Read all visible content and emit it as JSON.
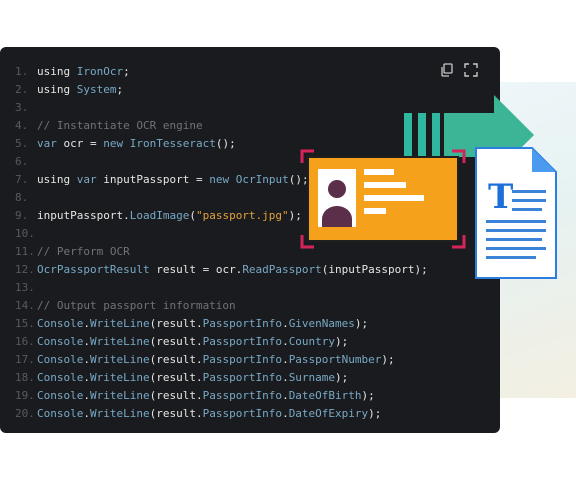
{
  "code": {
    "lines": [
      {
        "n": "1.",
        "tokens": [
          {
            "t": "using ",
            "c": "kw"
          },
          {
            "t": "IronOcr",
            "c": "ty"
          },
          {
            "t": ";",
            "c": "pl"
          }
        ]
      },
      {
        "n": "2.",
        "tokens": [
          {
            "t": "using ",
            "c": "kw"
          },
          {
            "t": "System",
            "c": "ty"
          },
          {
            "t": ";",
            "c": "pl"
          }
        ]
      },
      {
        "n": "3.",
        "tokens": []
      },
      {
        "n": "4.",
        "tokens": [
          {
            "t": "// Instantiate OCR engine",
            "c": "cm"
          }
        ]
      },
      {
        "n": "5.",
        "tokens": [
          {
            "t": "var",
            "c": "ty"
          },
          {
            "t": " ocr = ",
            "c": "pl"
          },
          {
            "t": "new",
            "c": "ty"
          },
          {
            "t": " ",
            "c": "pl"
          },
          {
            "t": "IronTesseract",
            "c": "ty"
          },
          {
            "t": "();",
            "c": "pl"
          }
        ]
      },
      {
        "n": "6.",
        "tokens": []
      },
      {
        "n": "7.",
        "tokens": [
          {
            "t": "using ",
            "c": "kw"
          },
          {
            "t": "var",
            "c": "ty"
          },
          {
            "t": " inputPassport = ",
            "c": "pl"
          },
          {
            "t": "new",
            "c": "ty"
          },
          {
            "t": " ",
            "c": "pl"
          },
          {
            "t": "OcrInput",
            "c": "ty"
          },
          {
            "t": "();",
            "c": "pl"
          }
        ]
      },
      {
        "n": "8.",
        "tokens": []
      },
      {
        "n": "9.",
        "tokens": [
          {
            "t": "inputPassport.",
            "c": "pl"
          },
          {
            "t": "LoadImage",
            "c": "ty"
          },
          {
            "t": "(",
            "c": "pl"
          },
          {
            "t": "\"passport.jpg\"",
            "c": "st"
          },
          {
            "t": ");",
            "c": "pl"
          }
        ]
      },
      {
        "n": "10.",
        "tokens": []
      },
      {
        "n": "11.",
        "tokens": [
          {
            "t": "// Perform OCR",
            "c": "cm"
          }
        ]
      },
      {
        "n": "12.",
        "tokens": [
          {
            "t": "OcrPassportResult",
            "c": "ty"
          },
          {
            "t": " result = ocr.",
            "c": "pl"
          },
          {
            "t": "ReadPassport",
            "c": "ty"
          },
          {
            "t": "(inputPassport);",
            "c": "pl"
          }
        ]
      },
      {
        "n": "13.",
        "tokens": []
      },
      {
        "n": "14.",
        "tokens": [
          {
            "t": "// Output passport information",
            "c": "cm"
          }
        ]
      },
      {
        "n": "15.",
        "tokens": [
          {
            "t": "Console",
            "c": "ty"
          },
          {
            "t": ".",
            "c": "pl"
          },
          {
            "t": "WriteLine",
            "c": "ty"
          },
          {
            "t": "(result.",
            "c": "pl"
          },
          {
            "t": "PassportInfo",
            "c": "ty"
          },
          {
            "t": ".",
            "c": "pl"
          },
          {
            "t": "GivenNames",
            "c": "ty"
          },
          {
            "t": ");",
            "c": "pl"
          }
        ]
      },
      {
        "n": "16.",
        "tokens": [
          {
            "t": "Console",
            "c": "ty"
          },
          {
            "t": ".",
            "c": "pl"
          },
          {
            "t": "WriteLine",
            "c": "ty"
          },
          {
            "t": "(result.",
            "c": "pl"
          },
          {
            "t": "PassportInfo",
            "c": "ty"
          },
          {
            "t": ".",
            "c": "pl"
          },
          {
            "t": "Country",
            "c": "ty"
          },
          {
            "t": ");",
            "c": "pl"
          }
        ]
      },
      {
        "n": "17.",
        "tokens": [
          {
            "t": "Console",
            "c": "ty"
          },
          {
            "t": ".",
            "c": "pl"
          },
          {
            "t": "WriteLine",
            "c": "ty"
          },
          {
            "t": "(result.",
            "c": "pl"
          },
          {
            "t": "PassportInfo",
            "c": "ty"
          },
          {
            "t": ".",
            "c": "pl"
          },
          {
            "t": "PassportNumber",
            "c": "ty"
          },
          {
            "t": ");",
            "c": "pl"
          }
        ]
      },
      {
        "n": "18.",
        "tokens": [
          {
            "t": "Console",
            "c": "ty"
          },
          {
            "t": ".",
            "c": "pl"
          },
          {
            "t": "WriteLine",
            "c": "ty"
          },
          {
            "t": "(result.",
            "c": "pl"
          },
          {
            "t": "PassportInfo",
            "c": "ty"
          },
          {
            "t": ".",
            "c": "pl"
          },
          {
            "t": "Surname",
            "c": "ty"
          },
          {
            "t": ");",
            "c": "pl"
          }
        ]
      },
      {
        "n": "19.",
        "tokens": [
          {
            "t": "Console",
            "c": "ty"
          },
          {
            "t": ".",
            "c": "pl"
          },
          {
            "t": "WriteLine",
            "c": "ty"
          },
          {
            "t": "(result.",
            "c": "pl"
          },
          {
            "t": "PassportInfo",
            "c": "ty"
          },
          {
            "t": ".",
            "c": "pl"
          },
          {
            "t": "DateOfBirth",
            "c": "ty"
          },
          {
            "t": ");",
            "c": "pl"
          }
        ]
      },
      {
        "n": "20.",
        "tokens": [
          {
            "t": "Console",
            "c": "ty"
          },
          {
            "t": ".",
            "c": "pl"
          },
          {
            "t": "WriteLine",
            "c": "ty"
          },
          {
            "t": "(result.",
            "c": "pl"
          },
          {
            "t": "PassportInfo",
            "c": "ty"
          },
          {
            "t": ".",
            "c": "pl"
          },
          {
            "t": "DateOfExpiry",
            "c": "ty"
          },
          {
            "t": ");",
            "c": "pl"
          }
        ]
      }
    ]
  },
  "toolbar": {
    "copy_icon": "copy-icon",
    "expand_icon": "expand-icon"
  },
  "illustration": {
    "card_icon": "id-card-icon",
    "arrow_icon": "arrow-right-icon",
    "doc_icon": "text-document-icon",
    "doc_letter": "T"
  },
  "colors": {
    "editor_bg": "#1a1b1e",
    "type": "#78a9c7",
    "comment": "#6d737b",
    "string": "#e2a13c",
    "card_orange": "#f5a11c",
    "frame_red": "#d6245a",
    "arrow_teal": "#3bb59a",
    "doc_blue": "#1e6fd9"
  }
}
